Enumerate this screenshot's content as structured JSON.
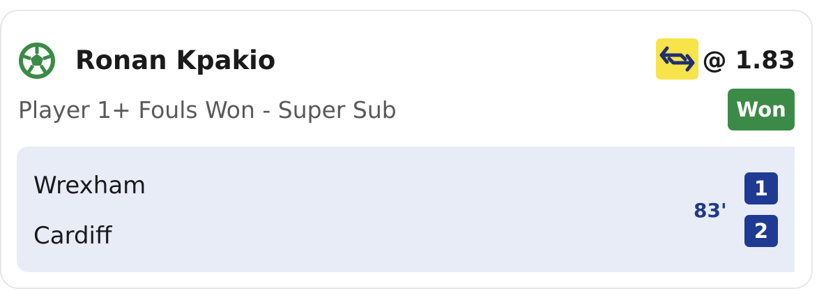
{
  "bet": {
    "sport_icon": "football-icon",
    "player_name": "Ronan Kpakio",
    "swap_icon": "bet-swap-icon",
    "odds": "@ 1.83",
    "market": "Player 1+ Fouls Won - Super Sub",
    "status": "Won"
  },
  "match": {
    "home_team": "Wrexham",
    "away_team": "Cardiff",
    "time": "83'",
    "home_score": "1",
    "away_score": "2"
  },
  "colors": {
    "status_won": "#3c8a47",
    "score_box": "#1f3a93",
    "swap_badge": "#f7e34a",
    "panel_bg": "#e8ecf7"
  }
}
